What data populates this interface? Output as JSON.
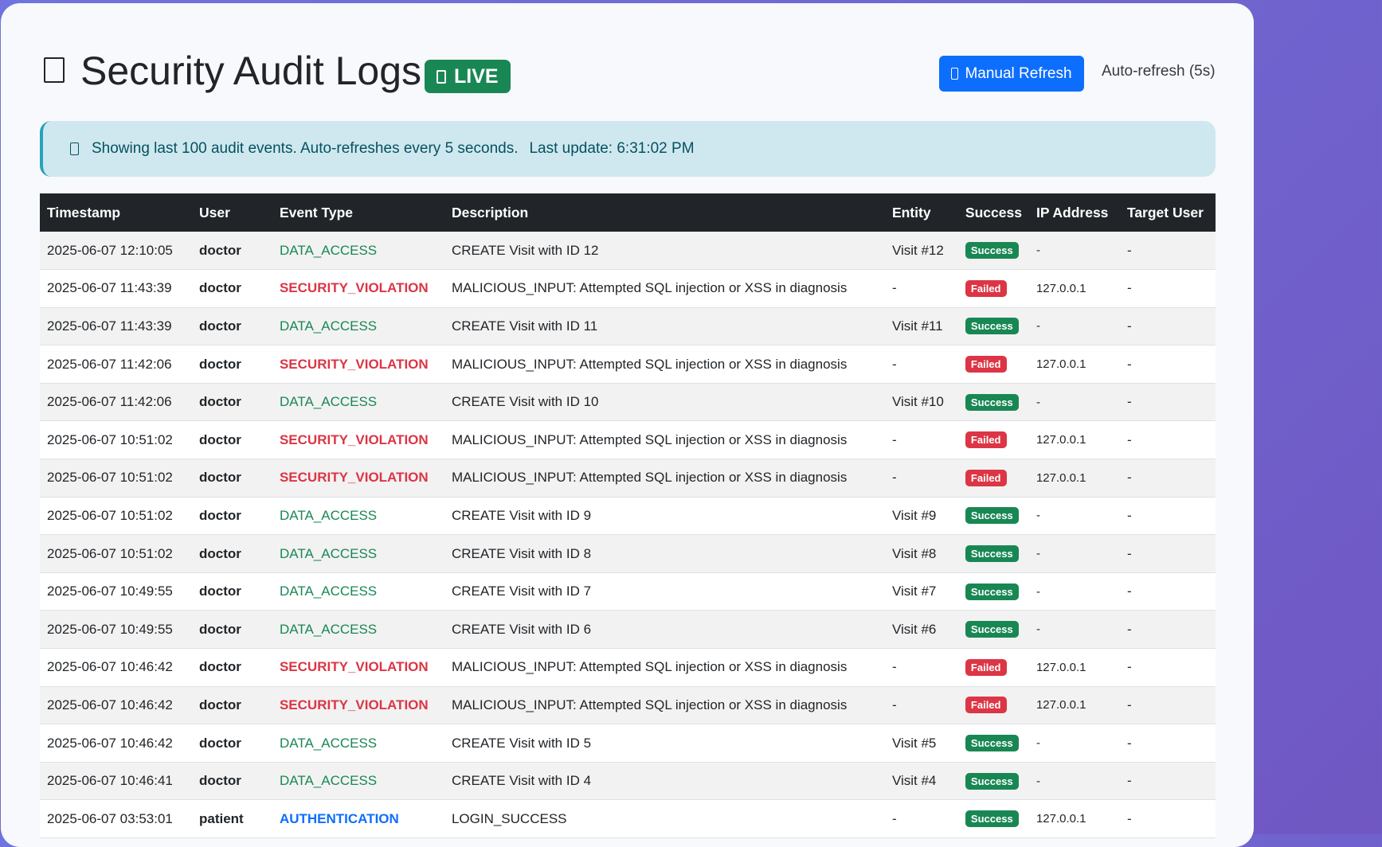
{
  "header": {
    "title": "Security Audit Logs",
    "title_icon": "clipboard-icon",
    "live_label": "LIVE",
    "live_icon": "broadcast-icon",
    "refresh_label": "Manual Refresh",
    "refresh_icon": "refresh-icon",
    "auto_refresh_label": "Auto-refresh (5s)"
  },
  "alert": {
    "icon": "info-icon",
    "message": "Showing last 100 audit events. Auto-refreshes every 5 seconds.",
    "last_update": "Last update: 6:31:02 PM"
  },
  "colors": {
    "background": "#7057c2",
    "live": "#198754",
    "primary": "#0d6efd",
    "success": "#198754",
    "failed": "#dc3545",
    "alert_bg": "#cfe8ef"
  },
  "table": {
    "columns": [
      "Timestamp",
      "User",
      "Event Type",
      "Description",
      "Entity",
      "Success",
      "IP Address",
      "Target User"
    ],
    "rows": [
      {
        "timestamp": "2025-06-07 12:10:05",
        "user": "doctor",
        "event_type": "DATA_ACCESS",
        "event_kind": "data",
        "description": "CREATE Visit with ID 12",
        "entity": "Visit #12",
        "success": "Success",
        "status": "ok",
        "ip": "-",
        "target_user": "-"
      },
      {
        "timestamp": "2025-06-07 11:43:39",
        "user": "doctor",
        "event_type": "SECURITY_VIOLATION",
        "event_kind": "sec",
        "description": "MALICIOUS_INPUT: Attempted SQL injection or XSS in diagnosis",
        "entity": "-",
        "success": "Failed",
        "status": "fail",
        "ip": "127.0.0.1",
        "target_user": "-"
      },
      {
        "timestamp": "2025-06-07 11:43:39",
        "user": "doctor",
        "event_type": "DATA_ACCESS",
        "event_kind": "data",
        "description": "CREATE Visit with ID 11",
        "entity": "Visit #11",
        "success": "Success",
        "status": "ok",
        "ip": "-",
        "target_user": "-"
      },
      {
        "timestamp": "2025-06-07 11:42:06",
        "user": "doctor",
        "event_type": "SECURITY_VIOLATION",
        "event_kind": "sec",
        "description": "MALICIOUS_INPUT: Attempted SQL injection or XSS in diagnosis",
        "entity": "-",
        "success": "Failed",
        "status": "fail",
        "ip": "127.0.0.1",
        "target_user": "-"
      },
      {
        "timestamp": "2025-06-07 11:42:06",
        "user": "doctor",
        "event_type": "DATA_ACCESS",
        "event_kind": "data",
        "description": "CREATE Visit with ID 10",
        "entity": "Visit #10",
        "success": "Success",
        "status": "ok",
        "ip": "-",
        "target_user": "-"
      },
      {
        "timestamp": "2025-06-07 10:51:02",
        "user": "doctor",
        "event_type": "SECURITY_VIOLATION",
        "event_kind": "sec",
        "description": "MALICIOUS_INPUT: Attempted SQL injection or XSS in diagnosis",
        "entity": "-",
        "success": "Failed",
        "status": "fail",
        "ip": "127.0.0.1",
        "target_user": "-"
      },
      {
        "timestamp": "2025-06-07 10:51:02",
        "user": "doctor",
        "event_type": "SECURITY_VIOLATION",
        "event_kind": "sec",
        "description": "MALICIOUS_INPUT: Attempted SQL injection or XSS in diagnosis",
        "entity": "-",
        "success": "Failed",
        "status": "fail",
        "ip": "127.0.0.1",
        "target_user": "-"
      },
      {
        "timestamp": "2025-06-07 10:51:02",
        "user": "doctor",
        "event_type": "DATA_ACCESS",
        "event_kind": "data",
        "description": "CREATE Visit with ID 9",
        "entity": "Visit #9",
        "success": "Success",
        "status": "ok",
        "ip": "-",
        "target_user": "-"
      },
      {
        "timestamp": "2025-06-07 10:51:02",
        "user": "doctor",
        "event_type": "DATA_ACCESS",
        "event_kind": "data",
        "description": "CREATE Visit with ID 8",
        "entity": "Visit #8",
        "success": "Success",
        "status": "ok",
        "ip": "-",
        "target_user": "-"
      },
      {
        "timestamp": "2025-06-07 10:49:55",
        "user": "doctor",
        "event_type": "DATA_ACCESS",
        "event_kind": "data",
        "description": "CREATE Visit with ID 7",
        "entity": "Visit #7",
        "success": "Success",
        "status": "ok",
        "ip": "-",
        "target_user": "-"
      },
      {
        "timestamp": "2025-06-07 10:49:55",
        "user": "doctor",
        "event_type": "DATA_ACCESS",
        "event_kind": "data",
        "description": "CREATE Visit with ID 6",
        "entity": "Visit #6",
        "success": "Success",
        "status": "ok",
        "ip": "-",
        "target_user": "-"
      },
      {
        "timestamp": "2025-06-07 10:46:42",
        "user": "doctor",
        "event_type": "SECURITY_VIOLATION",
        "event_kind": "sec",
        "description": "MALICIOUS_INPUT: Attempted SQL injection or XSS in diagnosis",
        "entity": "-",
        "success": "Failed",
        "status": "fail",
        "ip": "127.0.0.1",
        "target_user": "-"
      },
      {
        "timestamp": "2025-06-07 10:46:42",
        "user": "doctor",
        "event_type": "SECURITY_VIOLATION",
        "event_kind": "sec",
        "description": "MALICIOUS_INPUT: Attempted SQL injection or XSS in diagnosis",
        "entity": "-",
        "success": "Failed",
        "status": "fail",
        "ip": "127.0.0.1",
        "target_user": "-"
      },
      {
        "timestamp": "2025-06-07 10:46:42",
        "user": "doctor",
        "event_type": "DATA_ACCESS",
        "event_kind": "data",
        "description": "CREATE Visit with ID 5",
        "entity": "Visit #5",
        "success": "Success",
        "status": "ok",
        "ip": "-",
        "target_user": "-"
      },
      {
        "timestamp": "2025-06-07 10:46:41",
        "user": "doctor",
        "event_type": "DATA_ACCESS",
        "event_kind": "data",
        "description": "CREATE Visit with ID 4",
        "entity": "Visit #4",
        "success": "Success",
        "status": "ok",
        "ip": "-",
        "target_user": "-"
      },
      {
        "timestamp": "2025-06-07 03:53:01",
        "user": "patient",
        "event_type": "AUTHENTICATION",
        "event_kind": "auth",
        "description": "LOGIN_SUCCESS",
        "entity": "-",
        "success": "Success",
        "status": "ok",
        "ip": "127.0.0.1",
        "target_user": "-"
      }
    ]
  }
}
